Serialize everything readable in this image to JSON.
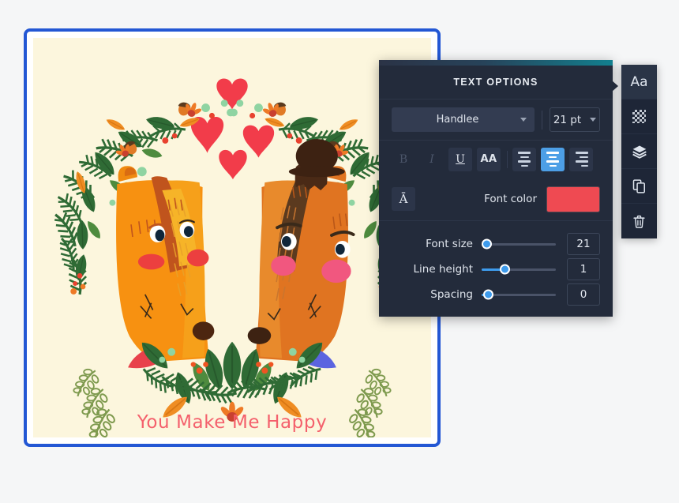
{
  "canvas": {
    "design_title": "You Make Me Happy",
    "background_color": "#fcf6dd",
    "selection_border_color": "#2357d4",
    "title_color": "#f4606c",
    "artwork_description": "Two foxes facing each other inside a floral wreath with red hearts above"
  },
  "panel": {
    "title": "TEXT OPTIONS",
    "font_family": "Handlee",
    "font_size_display": "21 pt",
    "format_buttons": [
      {
        "name": "bold",
        "label": "B",
        "state": "disabled"
      },
      {
        "name": "italic",
        "label": "I",
        "state": "disabled"
      },
      {
        "name": "underline",
        "label": "U",
        "state": "enabled"
      },
      {
        "name": "uppercase",
        "label": "AA",
        "state": "enabled"
      }
    ],
    "align_buttons": [
      {
        "name": "align-left",
        "active": false
      },
      {
        "name": "align-center",
        "active": true
      },
      {
        "name": "align-right",
        "active": false
      }
    ],
    "case_button_label": "Ā",
    "font_color_label": "Font color",
    "font_color_value": "#ef4a52",
    "sliders": [
      {
        "label": "Font size",
        "value": "21",
        "percent": 7
      },
      {
        "label": "Line height",
        "value": "1",
        "percent": 31
      },
      {
        "label": "Spacing",
        "value": "0",
        "percent": 9
      }
    ],
    "accent_gradient_end": "#12808f",
    "active_highlight_color": "#4d9fe6"
  },
  "sidebar": {
    "items": [
      {
        "icon": "text-icon",
        "label": "Aa",
        "active": true
      },
      {
        "icon": "transparency-icon",
        "label": "",
        "active": false
      },
      {
        "icon": "layers-icon",
        "label": "",
        "active": false
      },
      {
        "icon": "duplicate-icon",
        "label": "",
        "active": false
      },
      {
        "icon": "trash-icon",
        "label": "",
        "active": false
      }
    ]
  }
}
